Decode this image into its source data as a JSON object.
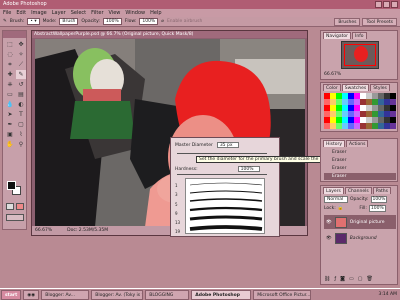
{
  "app": {
    "title": "Adobe Photoshop"
  },
  "menu": [
    "File",
    "Edit",
    "Image",
    "Layer",
    "Select",
    "Filter",
    "View",
    "Window",
    "Help"
  ],
  "options": {
    "brush_label": "Brush:",
    "mode_label": "Mode:",
    "mode_value": "Brush",
    "opacity_label": "Opacity:",
    "opacity_value": "100%",
    "flow_label": "Flow:",
    "flow_value": "100%",
    "airbrush_label": "Enable airbrush",
    "tabs": [
      "Brushes",
      "Tool Presets"
    ]
  },
  "document": {
    "title": "AbstractWallpaperPurple.psd @ 66.7% (Original picture, Quick Mask/8)",
    "zoom": "66.67%",
    "doc_size": "Doc: 2.53M/5.35M"
  },
  "brush_popup": {
    "diameter_label": "Master Diameter",
    "diameter_value": "35 px",
    "hardness_label": "Hardness:",
    "hardness_value": "100%",
    "tooltip": "Set the diameter for the primary brush and scale the dual brush",
    "presets": [
      "1",
      "3",
      "5",
      "9",
      "13",
      "19"
    ]
  },
  "navigator": {
    "tabs": [
      "Navigator",
      "Info"
    ],
    "zoom": "66.67%"
  },
  "swatches": {
    "tabs": [
      "Color",
      "Swatches",
      "Styles"
    ]
  },
  "history": {
    "tabs": [
      "History",
      "Actions"
    ],
    "items": [
      "Eraser",
      "Eraser",
      "Eraser",
      "Eraser"
    ]
  },
  "layers": {
    "tabs": [
      "Layers",
      "Channels",
      "Paths"
    ],
    "blend_mode": "Normal",
    "opacity_label": "Opacity:",
    "opacity_value": "100%",
    "lock_label": "Lock:",
    "fill_label": "Fill:",
    "fill_value": "100%",
    "items": [
      {
        "name": "Original picture"
      },
      {
        "name": "Background"
      }
    ]
  },
  "taskbar": {
    "start": "start",
    "tasks": [
      "Blogger: Av...",
      "Blogger: Av. (Toky is you...)",
      "BLOGGING",
      "Adobe Photoshop",
      "Microsoft Office Pictur..."
    ],
    "active_task": "Adobe Photoshop",
    "clock": "3:14 AM"
  },
  "colors": {
    "title_bar": "#b05d73",
    "quick_mask": "#e82020",
    "ui_bg": "#c9a3ac"
  }
}
